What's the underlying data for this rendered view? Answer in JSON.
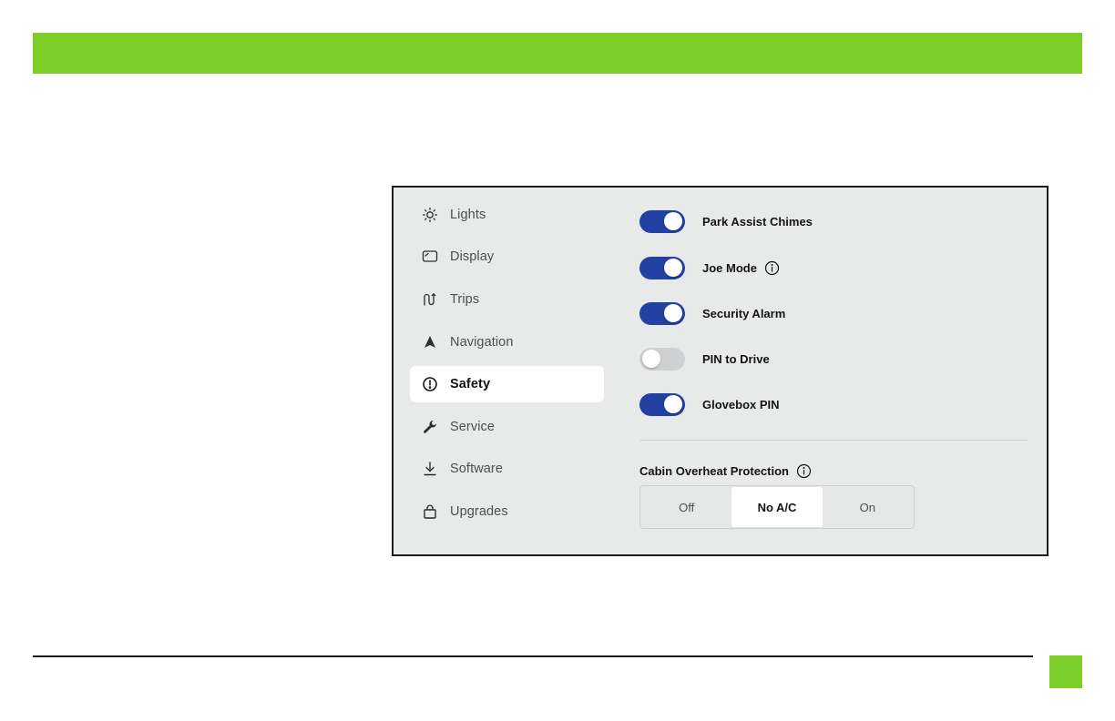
{
  "colors": {
    "accent": "#7dcd28",
    "toggle_on": "#2340a3",
    "toggle_off": "#cfd0d1",
    "screen_bg": "#e8e9e9"
  },
  "sidebar": {
    "items": [
      {
        "label": "Lights",
        "icon": "sun-icon"
      },
      {
        "label": "Display",
        "icon": "display-icon"
      },
      {
        "label": "Trips",
        "icon": "trips-icon"
      },
      {
        "label": "Navigation",
        "icon": "navigation-arrow-icon"
      },
      {
        "label": "Safety",
        "icon": "alert-circle-icon",
        "active": true
      },
      {
        "label": "Service",
        "icon": "wrench-icon"
      },
      {
        "label": "Software",
        "icon": "download-icon"
      },
      {
        "label": "Upgrades",
        "icon": "shopping-bag-icon"
      }
    ]
  },
  "settings": {
    "toggles": [
      {
        "label": "Park Assist Chimes",
        "on": true
      },
      {
        "label": "Joe Mode",
        "on": true,
        "info": true
      },
      {
        "label": "Security Alarm",
        "on": true
      },
      {
        "label": "PIN to Drive",
        "on": false
      },
      {
        "label": "Glovebox PIN",
        "on": true
      }
    ],
    "cabin_overheat": {
      "title": "Cabin Overheat Protection",
      "options": [
        "Off",
        "No A/C",
        "On"
      ],
      "selected": "No A/C"
    }
  }
}
